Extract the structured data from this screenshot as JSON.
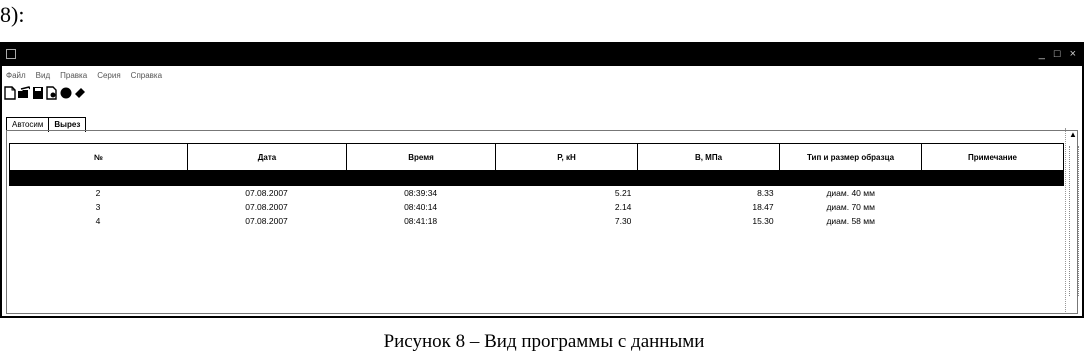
{
  "page": {
    "lead_text": "8):",
    "caption": "Рисунок 8 –  Вид программы с данными"
  },
  "window": {
    "title": "",
    "controls": [
      "_",
      "□",
      "×"
    ]
  },
  "menu": [
    "Файл",
    "Вид",
    "Правка",
    "Серия",
    "Справка"
  ],
  "toolbar": {
    "icons": [
      "new-file-icon",
      "open-folder-icon",
      "save-icon",
      "print-preview-icon",
      "record-icon",
      "erase-icon"
    ]
  },
  "tabs": [
    {
      "label": "Автосим",
      "active": true
    },
    {
      "label": "Вырез",
      "active": false
    }
  ],
  "table": {
    "columns": [
      "№",
      "Дата",
      "Время",
      "P, кН",
      "В, МПа",
      "Тип и размер образца",
      "Примечание"
    ],
    "rows": [
      [
        "2",
        "07.08.2007",
        "08:39:34",
        "5.21",
        "8.33",
        "диам. 40 мм",
        ""
      ],
      [
        "3",
        "07.08.2007",
        "08:40:14",
        "2.14",
        "18.47",
        "диам. 70 мм",
        ""
      ],
      [
        "4",
        "07.08.2007",
        "08:41:18",
        "7.30",
        "15.30",
        "диам. 58 мм",
        ""
      ]
    ]
  },
  "colors": {
    "selection": "#000000",
    "titlebar": "#000000"
  }
}
